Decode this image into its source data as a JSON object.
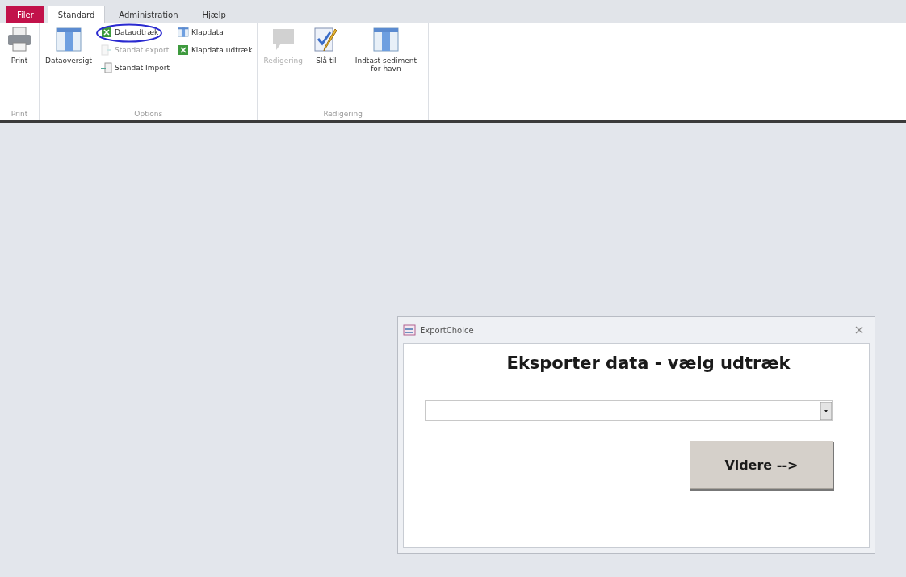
{
  "tabs": [
    {
      "label": "Filer",
      "kind": "file",
      "selected": false
    },
    {
      "label": "Standard",
      "kind": "tab",
      "selected": true
    },
    {
      "label": "Administration",
      "kind": "tab",
      "selected": false
    },
    {
      "label": "Hjælp",
      "kind": "tab",
      "selected": false
    }
  ],
  "ribbon_groups": [
    {
      "label": "Print",
      "columns": [
        [
          {
            "label": "Print",
            "kind": "printer",
            "disabled": false
          }
        ]
      ]
    },
    {
      "label": "Options",
      "columns": [
        [
          {
            "label": "Dataoversigt",
            "kind": "grid",
            "disabled": false
          }
        ],
        [
          {
            "label": "Dataudtræk",
            "kind": "spreadsheet",
            "disabled": false
          },
          {
            "label": "Standat export",
            "kind": "export",
            "disabled": true
          },
          {
            "label": "Standat Import",
            "kind": "import",
            "disabled": false
          }
        ],
        [
          {
            "label": "Klapdata",
            "kind": "minigrid",
            "disabled": false
          },
          {
            "label": "Klapdata udtræk",
            "kind": "spreadsheet",
            "disabled": false
          }
        ]
      ]
    },
    {
      "label": "Redigering",
      "columns": [
        [
          {
            "label": "Redigering",
            "kind": "bubble",
            "disabled": true
          }
        ],
        [
          {
            "label": "Slå til",
            "kind": "checklist",
            "disabled": false
          }
        ],
        [
          {
            "label": "Indtast sediment for havn",
            "kind": "grid",
            "disabled": false
          }
        ]
      ]
    }
  ],
  "dialog": {
    "title": "ExportChoice",
    "heading": "Eksporter data - vælg udtræk",
    "button": "Videre -->"
  }
}
